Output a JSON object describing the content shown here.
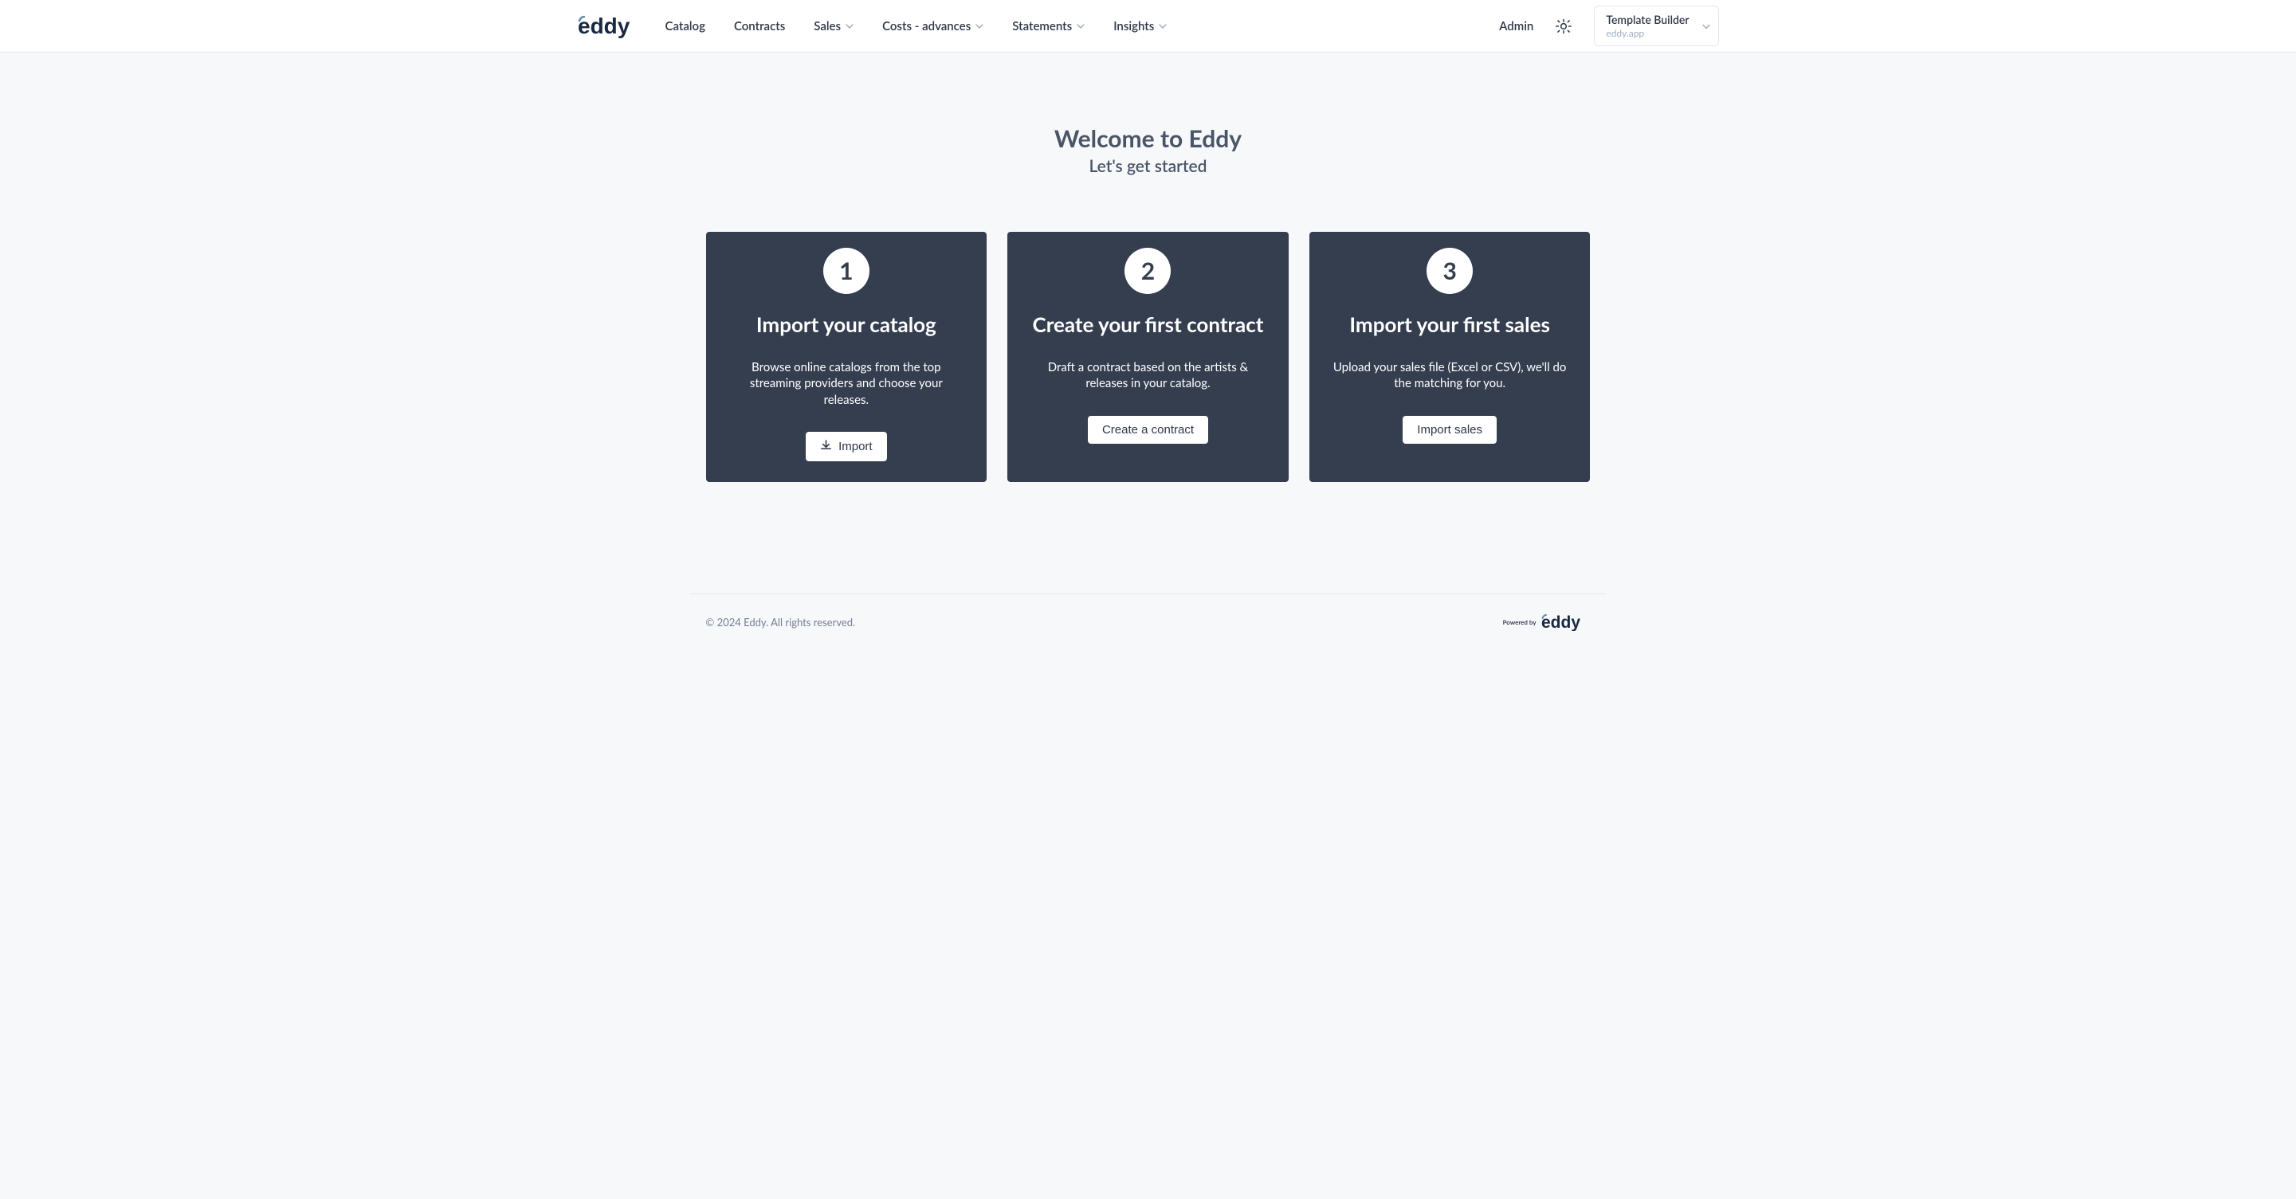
{
  "logo_text": "eddy",
  "nav": {
    "catalog": "Catalog",
    "contracts": "Contracts",
    "sales": "Sales",
    "costs": "Costs - advances",
    "statements": "Statements",
    "insights": "Insights",
    "admin": "Admin"
  },
  "account": {
    "name": "Template Builder",
    "domain": "eddy.app"
  },
  "welcome": {
    "title": "Welcome to Eddy",
    "subtitle": "Let's get started"
  },
  "cards": [
    {
      "number": "1",
      "title": "Import your catalog",
      "description": "Browse online catalogs from the top streaming providers and choose your releases.",
      "button": "Import",
      "has_icon": true
    },
    {
      "number": "2",
      "title": "Create your first contract",
      "description": "Draft a contract based on the artists & releases in your catalog.",
      "button": "Create a contract",
      "has_icon": false
    },
    {
      "number": "3",
      "title": "Import your first sales",
      "description": "Upload your sales file (Excel or CSV), we'll do the matching for you.",
      "button": "Import sales",
      "has_icon": false
    }
  ],
  "footer": {
    "copyright": "© 2024 Eddy. All rights reserved.",
    "powered_by": "Powered by"
  }
}
